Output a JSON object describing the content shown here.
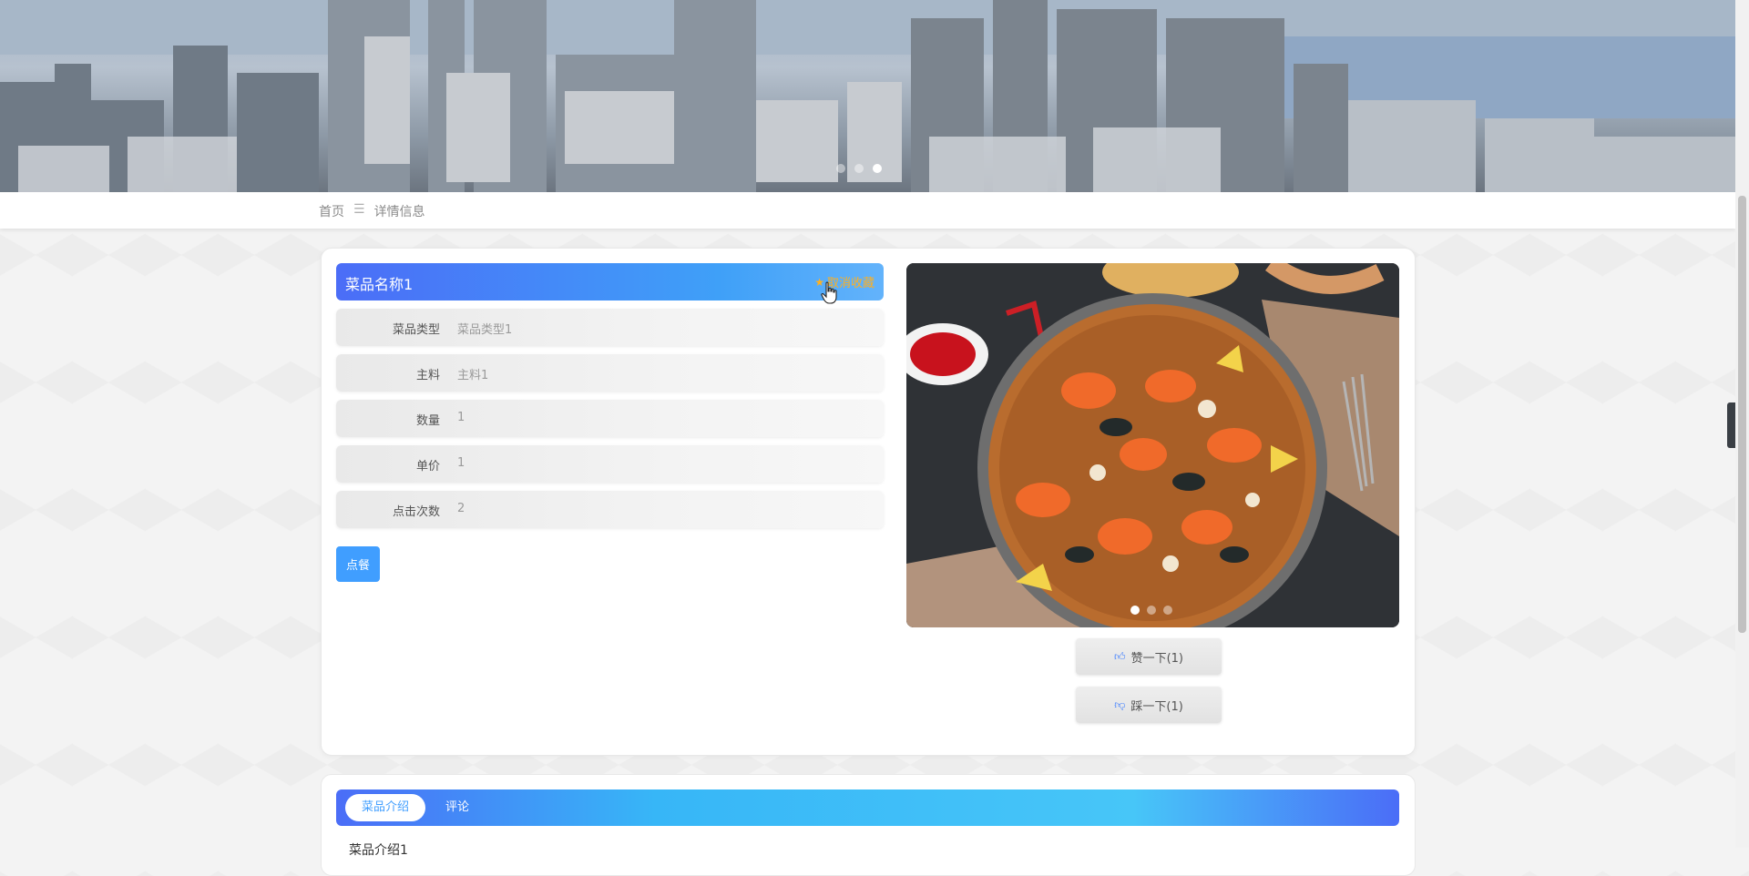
{
  "breadcrumb": {
    "home": "首页",
    "separator": "☰",
    "current": "详情信息"
  },
  "banner": {
    "dots": 3,
    "active_dot": 2
  },
  "product": {
    "name": "菜品名称1",
    "favorite_label": "取消收藏",
    "fields": [
      {
        "label": "菜品类型",
        "value": "菜品类型1"
      },
      {
        "label": "主料",
        "value": "主料1"
      },
      {
        "label": "数量",
        "value": "1"
      },
      {
        "label": "单价",
        "value": "1"
      },
      {
        "label": "点击次数",
        "value": "2"
      }
    ],
    "order_label": "点餐",
    "like_label": "赞一下(1)",
    "dislike_label": "踩一下(1)",
    "photo_dots": 3,
    "photo_active_dot": 0
  },
  "tabs": [
    {
      "label": "菜品介绍",
      "active": true
    },
    {
      "label": "评论",
      "active": false
    }
  ],
  "intro_text": "菜品介绍1",
  "icons": {
    "star": "star-icon",
    "thumbs_up": "thumbs-up-icon",
    "thumbs_down": "thumbs-down-icon",
    "chevron": "chevron-left-icon"
  },
  "colors": {
    "primary": "#409eff",
    "title_gradient_start": "#4b6df7",
    "favorite": "#ffb020"
  }
}
